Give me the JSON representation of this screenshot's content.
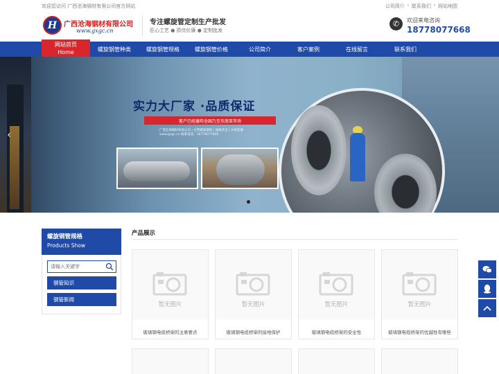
{
  "topbar": {
    "welcome": "欢迎您访问 广西沧海钢材有限公司官方网站",
    "links": [
      "公司简介",
      "联系我们",
      "网站地图"
    ]
  },
  "header": {
    "logo_mark": "H",
    "company_name": "广西沧海钢材有限公司",
    "company_url": "www.gxgc.cn",
    "slogan_title": "专注螺旋管定制生产批发",
    "slogan_sub": "匠心工艺 ● 质优价廉 ● 定制批发",
    "hotline_label": "欢迎来电咨询",
    "hotline_number": "18778077668"
  },
  "nav": {
    "home_cn": "网站首页",
    "home_en": "Home",
    "items": [
      "螺旋钢管种类",
      "螺旋钢管规格",
      "螺旋钢管价格",
      "公司简介",
      "客户案例",
      "在线留言",
      "联系我们"
    ]
  },
  "banner": {
    "headline": "实力大厂家 ·品质保证",
    "ribbon": "客户已经遍布全国乃至东南亚市场",
    "small_line1": "广西沧海钢材有限公司 | 主营螺旋钢管 | 规格齐全 | 价格实惠",
    "small_line2": "www.gxgc.cn        联系电话：18778077668",
    "active_slide": 2,
    "slide_count": 2
  },
  "sidebar": {
    "title": "螺旋钢管规格",
    "subtitle": "Products Show",
    "search_placeholder": "请输入关键字",
    "links": [
      "钢管知识",
      "钢管新闻"
    ]
  },
  "products": {
    "title": "产品展示",
    "no_image_text": "暂无图片",
    "items": [
      {
        "caption": "玻璃钢电缆桥架的注意要点"
      },
      {
        "caption": "玻璃钢电缆桥架的接地保护"
      },
      {
        "caption": "玻璃钢电缆桥架的安全性"
      },
      {
        "caption": "玻璃钢电缆桥架的优越性有哪些"
      }
    ]
  },
  "float_tools": [
    "wechat-icon",
    "qq-icon",
    "back-to-top-icon"
  ],
  "colors": {
    "primary": "#1f4aa8",
    "accent": "#d8262c"
  }
}
